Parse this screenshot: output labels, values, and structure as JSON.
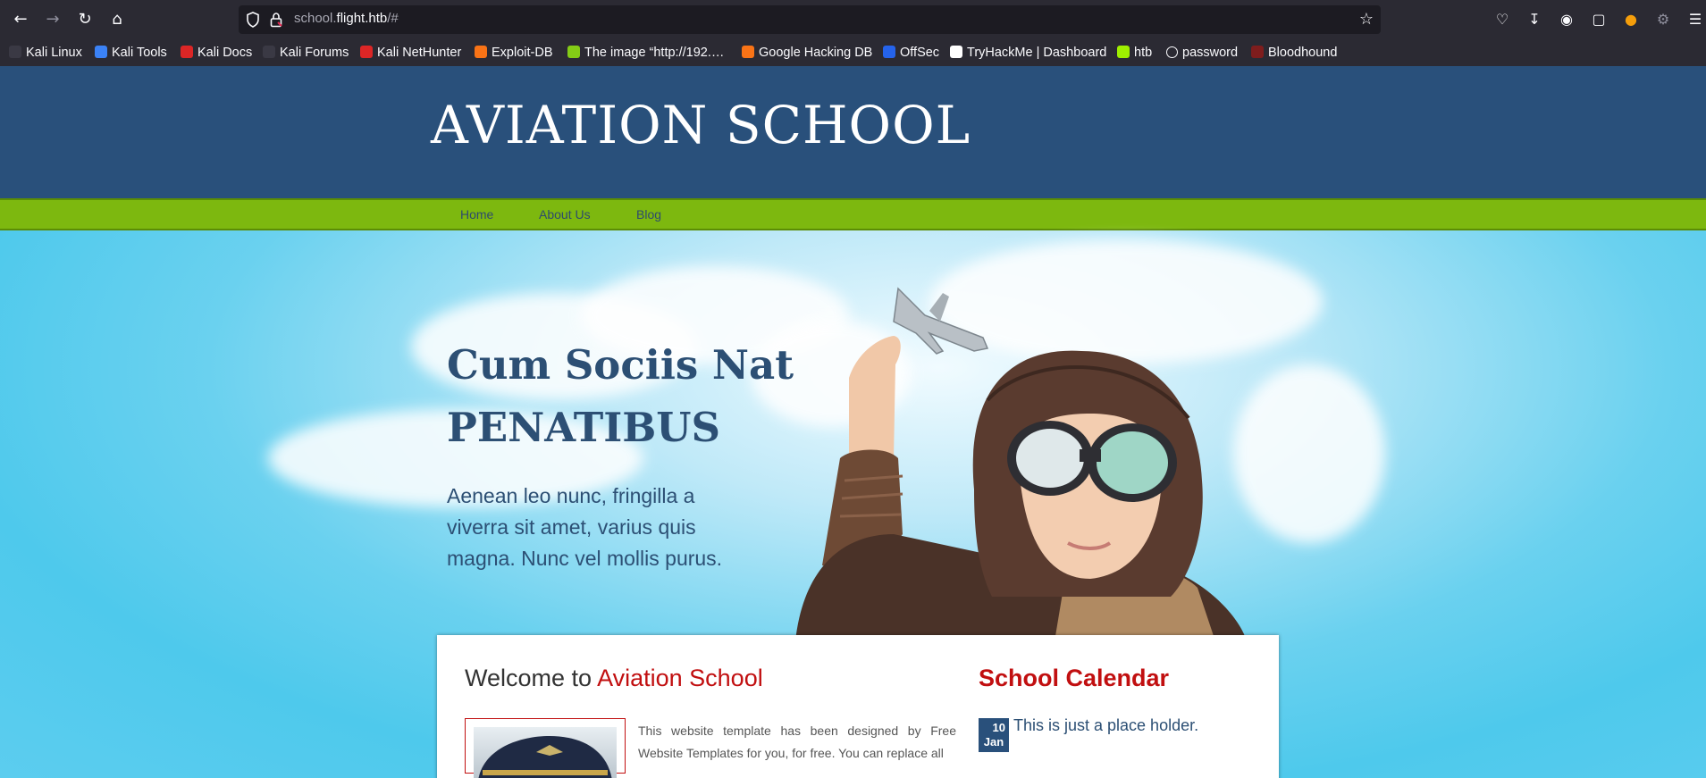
{
  "browser": {
    "url_host_prefix": "school.",
    "url_host_main": "flight.htb",
    "url_path": "/#"
  },
  "bookmarks": [
    {
      "label": "Kali Linux",
      "color": "#ffffff"
    },
    {
      "label": "Kali Tools",
      "color": "#3b82f6"
    },
    {
      "label": "Kali Docs",
      "color": "#dc2626"
    },
    {
      "label": "Kali Forums",
      "color": "#ffffff"
    },
    {
      "label": "Kali NetHunter",
      "color": "#dc2626"
    },
    {
      "label": "Exploit-DB",
      "color": "#f97316"
    },
    {
      "label": "The image “http://192.…",
      "color": "#84cc16"
    },
    {
      "label": "Google Hacking DB",
      "color": "#f97316"
    },
    {
      "label": "OffSec",
      "color": "#2563eb"
    },
    {
      "label": "TryHackMe | Dashboard",
      "color": "#dc2626"
    },
    {
      "label": "htb",
      "color": "#9fef00"
    },
    {
      "label": "password",
      "color": "#ffffff"
    },
    {
      "label": "Bloodhound",
      "color": "#dc2626"
    }
  ],
  "site": {
    "logo": "AVIATION SCHOOL",
    "menu": [
      "Home",
      "About Us",
      "Blog"
    ],
    "hero": {
      "title_line1": "Cum Sociis Nat",
      "title_line2": "PENATIBUS",
      "subtitle": "Aenean leo nunc, fringilla a viverra sit amet, varius quis magna. Nunc vel mollis purus."
    },
    "welcome_prefix": "Welcome to ",
    "welcome_name": "Aviation School",
    "body_text": "This website template has been designed by Free Website Templates for you, for free. You can replace all",
    "calendar_title": "School Calendar",
    "calendar_day": "10",
    "calendar_month": "Jan",
    "calendar_text": "This is just a place holder."
  },
  "colors": {
    "header": "#29507b",
    "menu": "#7db80f",
    "accent_red": "#c10f10"
  }
}
